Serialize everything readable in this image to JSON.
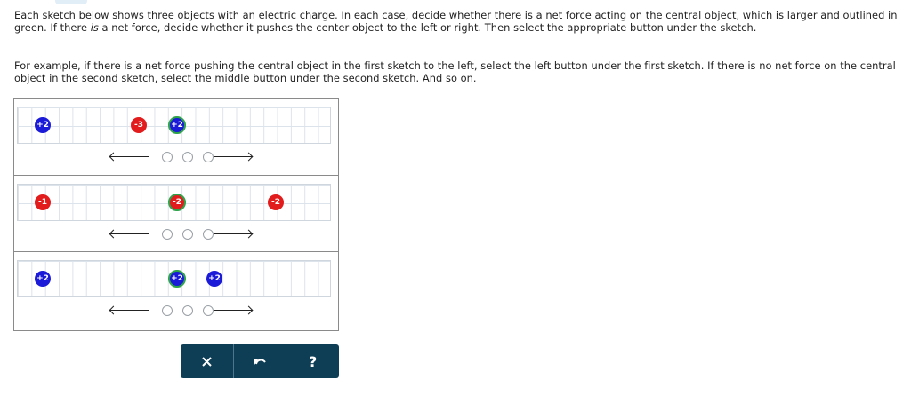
{
  "instructions": {
    "paragraph1_start": "Each sketch below shows three objects with an electric charge. In each case, decide whether there is a net force acting on the central object, which is larger and outlined in green. If there ",
    "paragraph1_em": "is",
    "paragraph1_end": " a net force, decide whether it pushes the center object to the left or right. Then select the appropriate button under the sketch.",
    "paragraph2": "For example, if there is a net force pushing the central object in the first sketch to the left, select the left button under the first sketch. If there is no net force on the central object in the second sketch, select the middle button under the second sketch. And so on."
  },
  "sketches": [
    {
      "charges": [
        {
          "label": "+2",
          "sign": "positive",
          "central": false
        },
        {
          "label": "-3",
          "sign": "negative",
          "central": false
        },
        {
          "label": "+2",
          "sign": "positive",
          "central": true
        }
      ]
    },
    {
      "charges": [
        {
          "label": "-1",
          "sign": "negative",
          "central": false
        },
        {
          "label": "-2",
          "sign": "negative",
          "central": true
        },
        {
          "label": "-2",
          "sign": "negative",
          "central": false
        }
      ]
    },
    {
      "charges": [
        {
          "label": "+2",
          "sign": "positive",
          "central": false
        },
        {
          "label": "+2",
          "sign": "positive",
          "central": true
        },
        {
          "label": "+2",
          "sign": "positive",
          "central": false
        }
      ]
    }
  ],
  "colors": {
    "positive": "#1a1ad8",
    "negative": "#e21c1c",
    "central_outline": "#2fa34a",
    "toolbar": "#0d3e55"
  },
  "toolbar": {
    "clear_icon": "close-icon",
    "undo_icon": "undo-icon",
    "help_label": "?"
  }
}
